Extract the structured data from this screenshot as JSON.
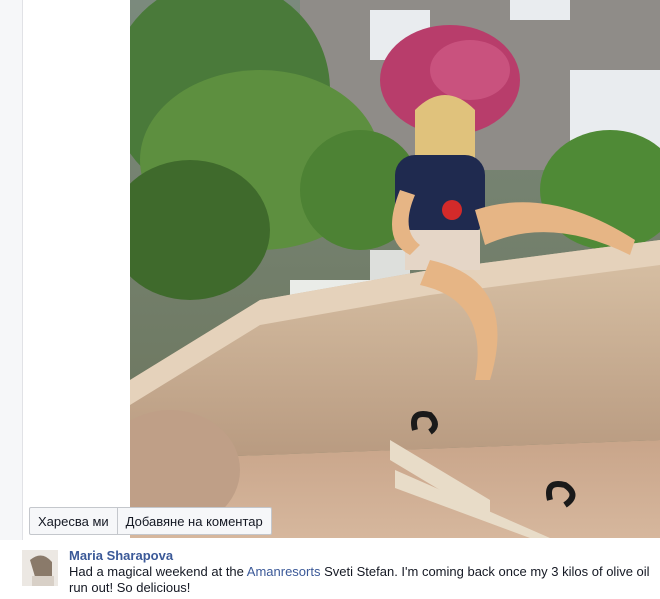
{
  "post": {
    "photo_alt": "",
    "actions": {
      "like_label": "Харесва ми",
      "comment_label": "Добавяне на коментар"
    }
  },
  "comment": {
    "author": "Maria Sharapova",
    "text_before_link": "Had a magical weekend at the ",
    "link_text": "Amanresorts",
    "text_after_link": " Sveti Stefan. I'm coming back once my 3 kilos of olive oil run out! So delicious!"
  },
  "colors": {
    "link": "#3b5998",
    "text": "#141823",
    "button_bg": "#f6f7f9",
    "button_border": "#c4c7cc"
  }
}
